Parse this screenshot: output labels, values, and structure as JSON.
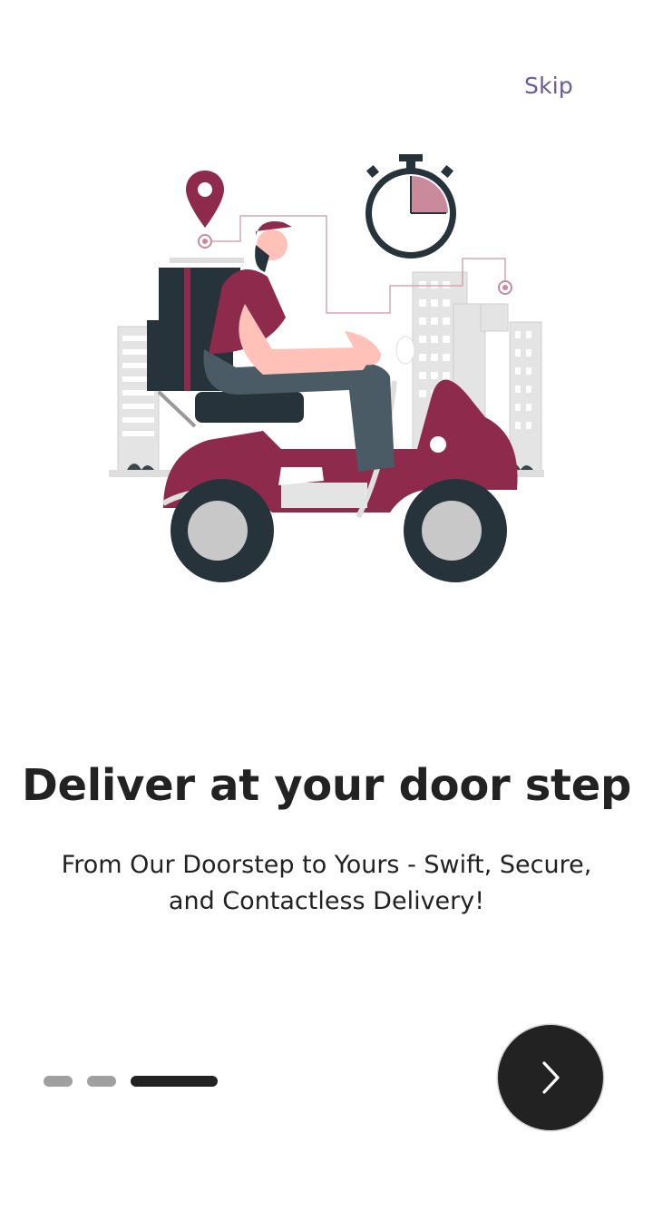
{
  "header": {
    "skip_label": "Skip"
  },
  "illustration": {
    "icon": "delivery-scooter-illustration"
  },
  "content": {
    "title": "Deliver at your door step",
    "subtitle_line1": "From Our Doorstep to Yours - Swift, Secure,",
    "subtitle_line2": "and Contactless Delivery!"
  },
  "pagination": {
    "count": 3,
    "current": 3
  },
  "next_button": {
    "icon": "chevron-right-icon"
  },
  "colors": {
    "accent": "#6b5b95",
    "brand": "#8e2a4b",
    "dark": "#222222",
    "inactive_dot": "#a0a0a0"
  }
}
